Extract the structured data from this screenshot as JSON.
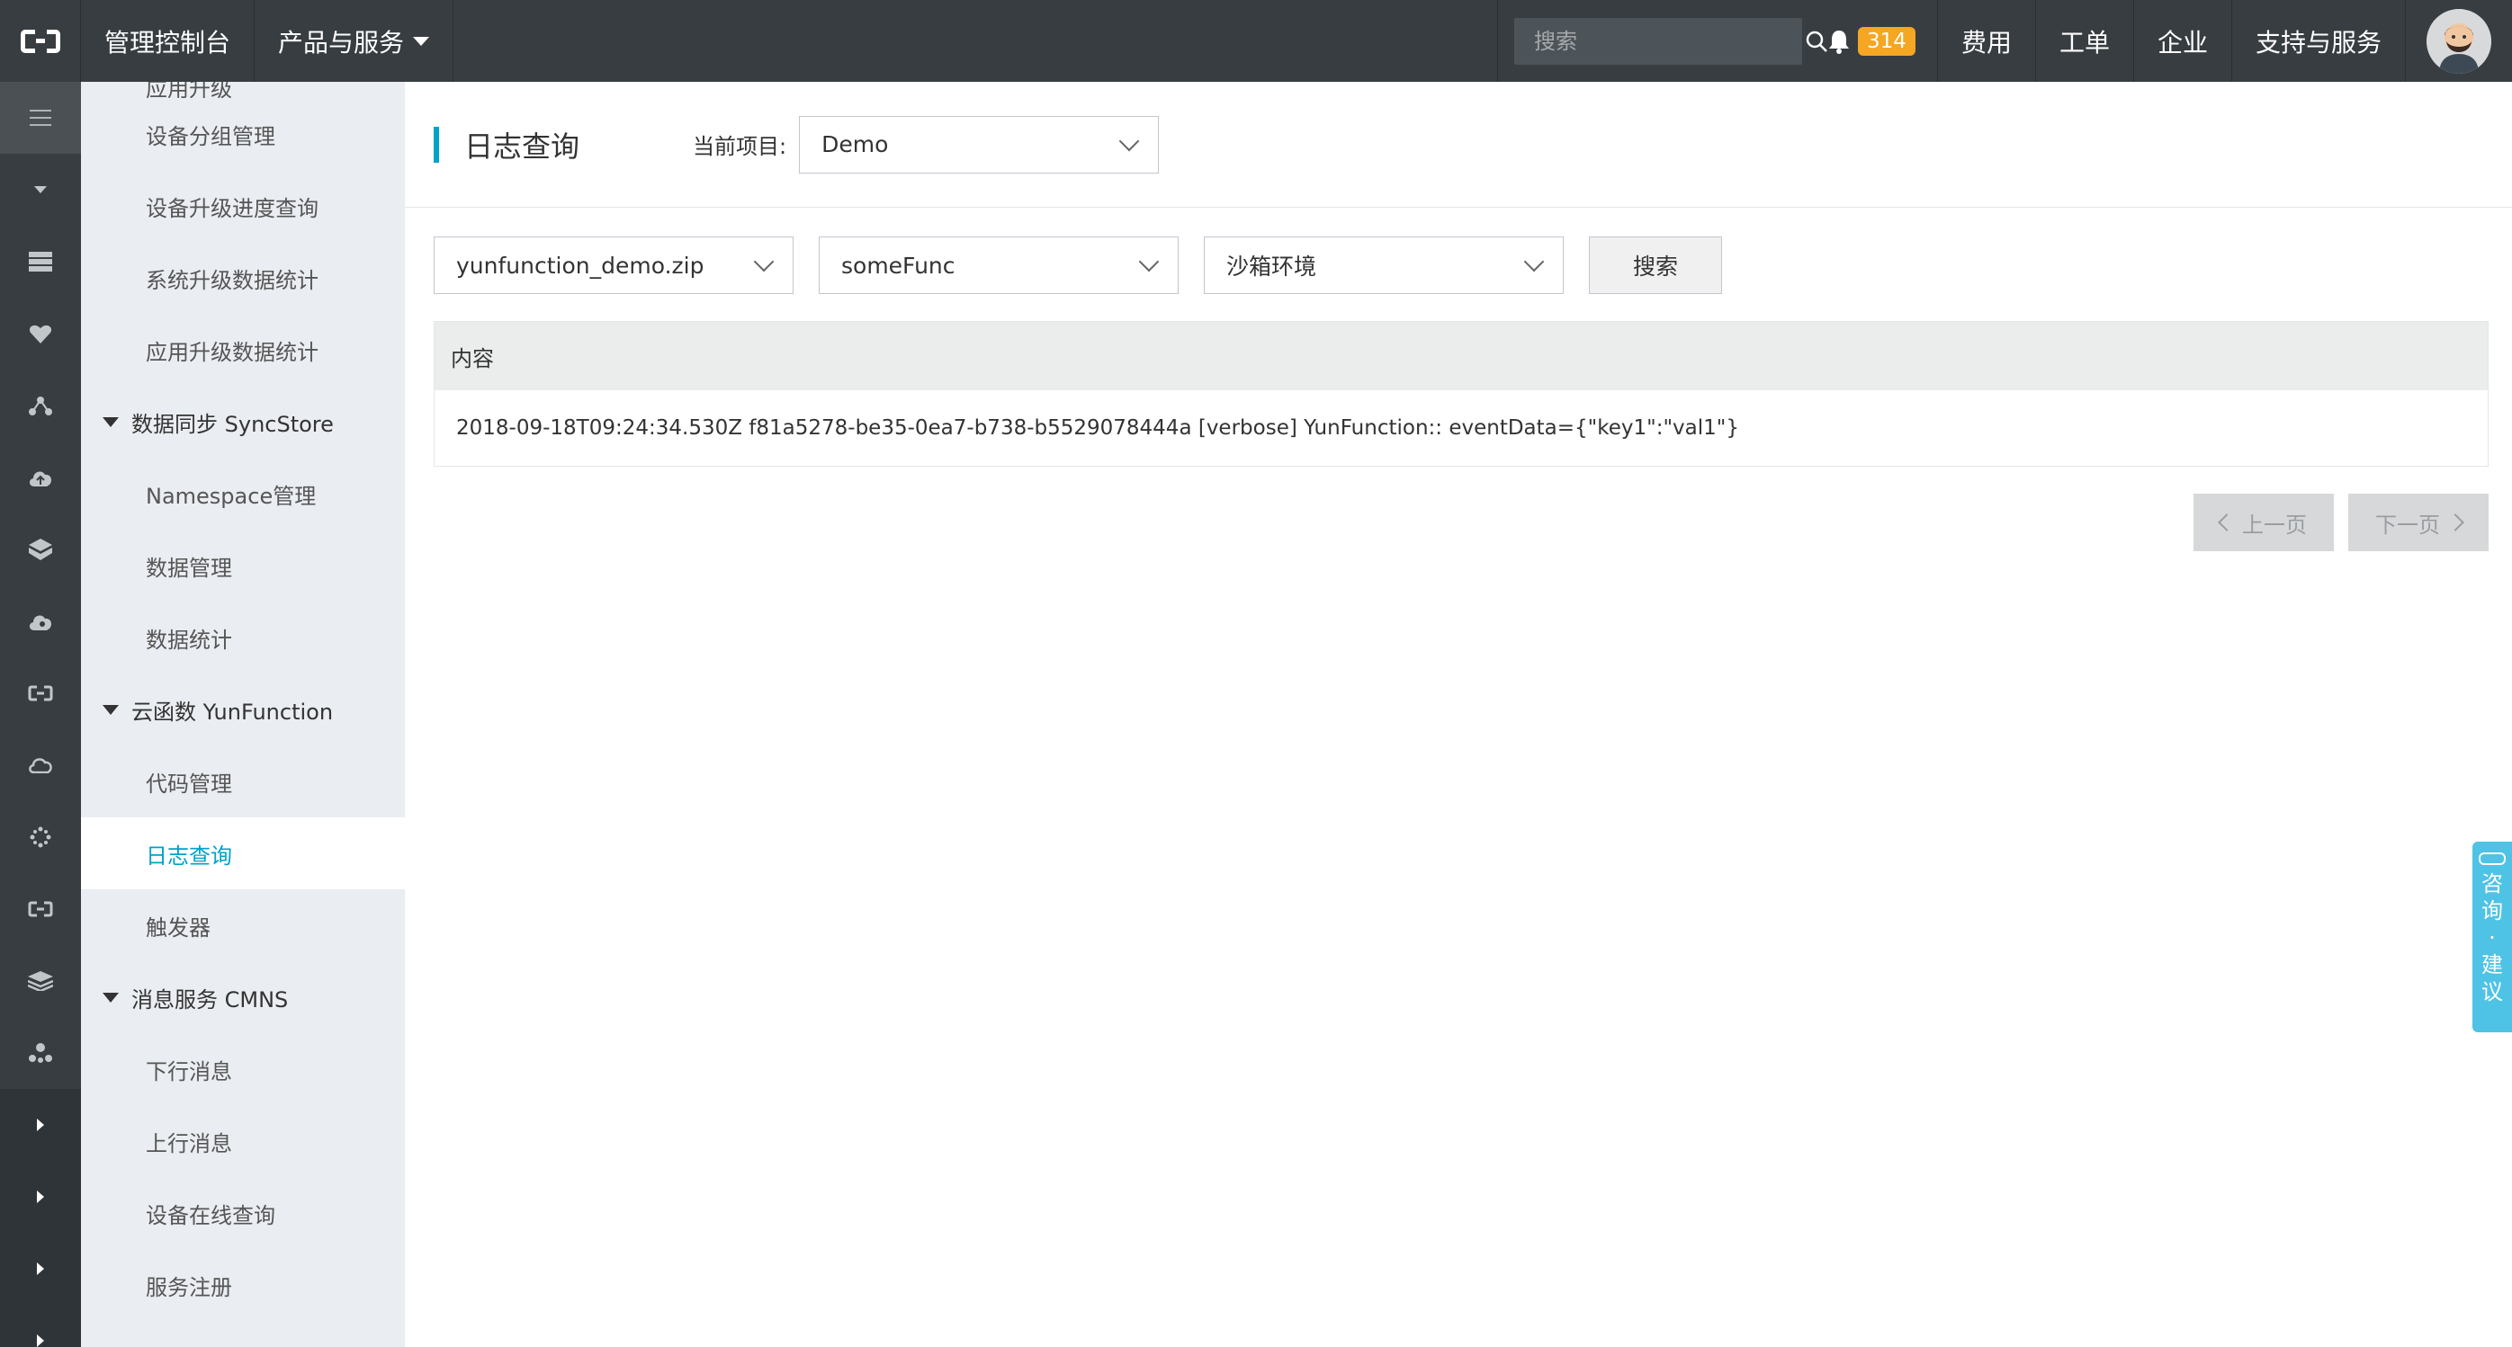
{
  "topbar": {
    "console": "管理控制台",
    "products": "产品与服务",
    "search_placeholder": "搜索",
    "notification_count": "314",
    "links": [
      "费用",
      "工单",
      "企业",
      "支持与服务"
    ]
  },
  "rail": {
    "icons": [
      "menu-icon",
      "caret-down-icon",
      "server-icon",
      "heart-icon",
      "network-icon",
      "cloud-upload-icon",
      "cube-icon",
      "cloud-gear-icon",
      "link-icon",
      "cloud-icon",
      "sparkle-icon",
      "link-icon",
      "layers-icon",
      "cluster-icon",
      "caret-right-icon",
      "caret-right-icon",
      "caret-right-icon",
      "caret-right-icon"
    ]
  },
  "sidebar": {
    "cutoff_item": "应用升级",
    "ota_items": [
      "设备分组管理",
      "设备升级进度查询",
      "系统升级数据统计",
      "应用升级数据统计"
    ],
    "sync_group": "数据同步 SyncStore",
    "sync_items": [
      "Namespace管理",
      "数据管理",
      "数据统计"
    ],
    "fn_group": "云函数 YunFunction",
    "fn_items": [
      "代码管理",
      "日志查询",
      "触发器"
    ],
    "mq_group": "消息服务 CMNS",
    "mq_items": [
      "下行消息",
      "上行消息",
      "设备在线查询",
      "服务注册"
    ]
  },
  "main": {
    "title": "日志查询",
    "project_label": "当前项目:",
    "project_value": "Demo",
    "filter_package": "yunfunction_demo.zip",
    "filter_function": "someFunc",
    "filter_env": "沙箱环境",
    "search_button": "搜索",
    "table_header": "内容",
    "rows": [
      "2018-09-18T09:24:34.530Z f81a5278-be35-0ea7-b738-b5529078444a [verbose] YunFunction:: eventData={\"key1\":\"val1\"}"
    ],
    "prev_page": "上一页",
    "next_page": "下一页"
  },
  "feedback": {
    "chars": [
      "咨",
      "询",
      "·",
      "建",
      "议"
    ]
  },
  "colors": {
    "accent": "#00a2ca",
    "topbar": "#373d41",
    "badge": "#f5a623",
    "sidebar": "#eaedf1",
    "feedback": "#4fc3e5"
  }
}
